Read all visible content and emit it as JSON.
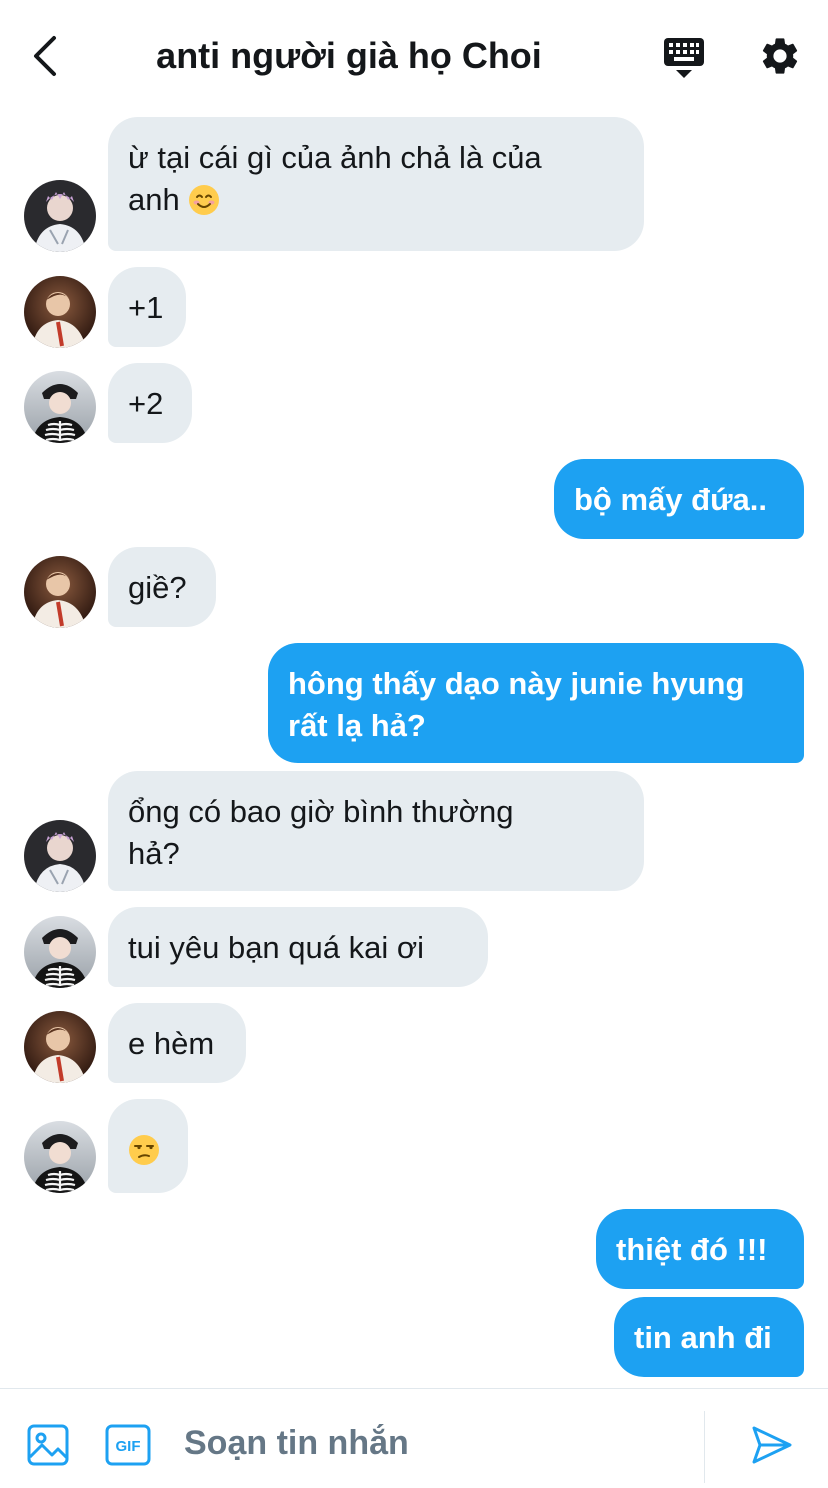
{
  "header": {
    "title": "anti người già họ Choi",
    "back_icon": "chevron-left-icon",
    "keyboard_icon": "keyboard-icon",
    "settings_icon": "gear-icon"
  },
  "messages": [
    {
      "from": "them",
      "avatar": "avatar-1",
      "text": "ừ tại cái gì của ảnh chả là của",
      "text2": "anh",
      "emoji": "smiling-face"
    },
    {
      "from": "them",
      "avatar": "avatar-2",
      "text": "+1"
    },
    {
      "from": "them",
      "avatar": "avatar-3",
      "text": "+2"
    },
    {
      "from": "me",
      "text": "bộ mấy đứa.."
    },
    {
      "from": "them",
      "avatar": "avatar-2",
      "text": "giề?"
    },
    {
      "from": "me",
      "text": "hông thấy dạo này junie hyung",
      "text2": "rất lạ hả?"
    },
    {
      "from": "them",
      "avatar": "avatar-1",
      "text": "ổng có bao giờ bình thường",
      "text2": "hả?"
    },
    {
      "from": "them",
      "avatar": "avatar-3",
      "text": "tui yêu bạn quá kai ơi"
    },
    {
      "from": "them",
      "avatar": "avatar-2",
      "text": "e hèm"
    },
    {
      "from": "them",
      "avatar": "avatar-3",
      "emoji": "unamused-face"
    },
    {
      "from": "me",
      "text": "thiệt đó !!!"
    },
    {
      "from": "me",
      "text": "tin anh đi"
    }
  ],
  "composer": {
    "placeholder": "Soạn tin nhắn",
    "image_icon": "image-icon",
    "gif_icon": "gif-icon",
    "gif_label": "GIF",
    "send_icon": "send-icon"
  },
  "colors": {
    "accent": "#1da1f2",
    "incoming_bubble": "#e6ecf0",
    "text": "#14171a",
    "placeholder": "#657786"
  }
}
